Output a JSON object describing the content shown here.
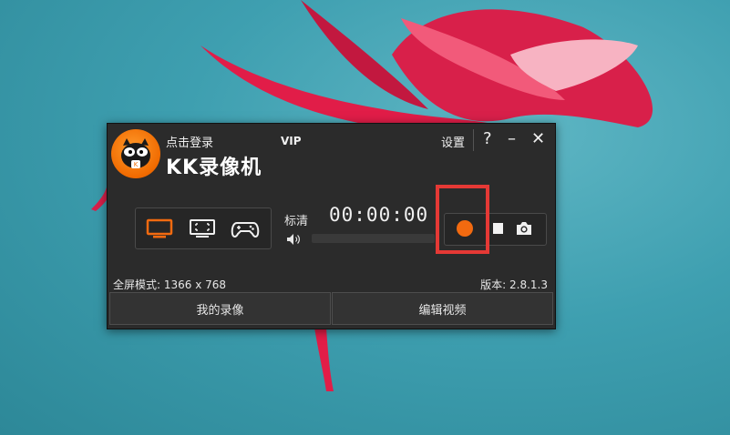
{
  "app": {
    "login_text": "点击登录",
    "vip_text": "VIP",
    "name": "KK录像机",
    "settings_label": "设置",
    "help_label": "?",
    "minimize_label": "–",
    "close_label": "✕"
  },
  "recording": {
    "quality_label": "标清",
    "timer": "00:00:00"
  },
  "status": {
    "fullscreen_mode": "全屏模式: 1366 x 768",
    "version": "版本: 2.8.1.3"
  },
  "actions": {
    "my_recordings": "我的录像",
    "edit_video": "编辑视频"
  },
  "colors": {
    "accent": "#f26a10",
    "highlight": "#e53935",
    "window_bg": "#2b2b2b"
  }
}
